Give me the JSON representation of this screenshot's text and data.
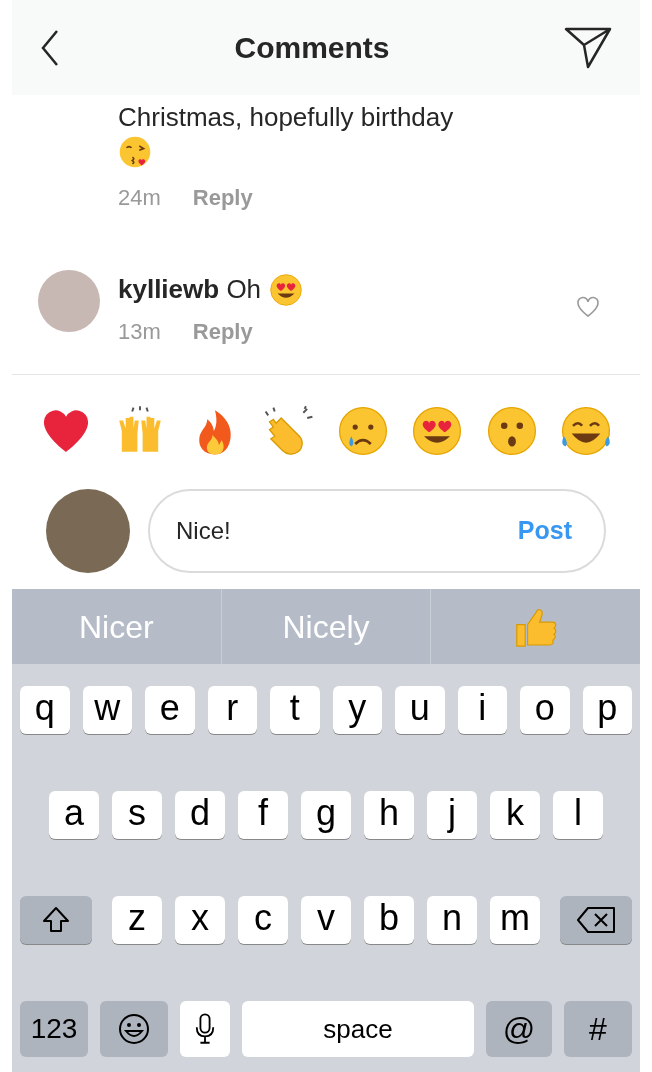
{
  "header": {
    "title": "Comments"
  },
  "comments": [
    {
      "text": "Christmas, hopefully birthday",
      "time": "24m",
      "reply": "Reply"
    },
    {
      "username": "kylliewb",
      "text": "Oh",
      "time": "13m",
      "reply": "Reply"
    }
  ],
  "composer": {
    "value": "Nice!",
    "post": "Post"
  },
  "keyboard": {
    "suggestions": [
      "Nicer",
      "Nicely"
    ],
    "rows": [
      [
        "q",
        "w",
        "e",
        "r",
        "t",
        "y",
        "u",
        "i",
        "o",
        "p"
      ],
      [
        "a",
        "s",
        "d",
        "f",
        "g",
        "h",
        "j",
        "k",
        "l"
      ],
      [
        "z",
        "x",
        "c",
        "v",
        "b",
        "n",
        "m"
      ]
    ],
    "numbers": "123",
    "space": "space",
    "at": "@",
    "hash": "#"
  }
}
